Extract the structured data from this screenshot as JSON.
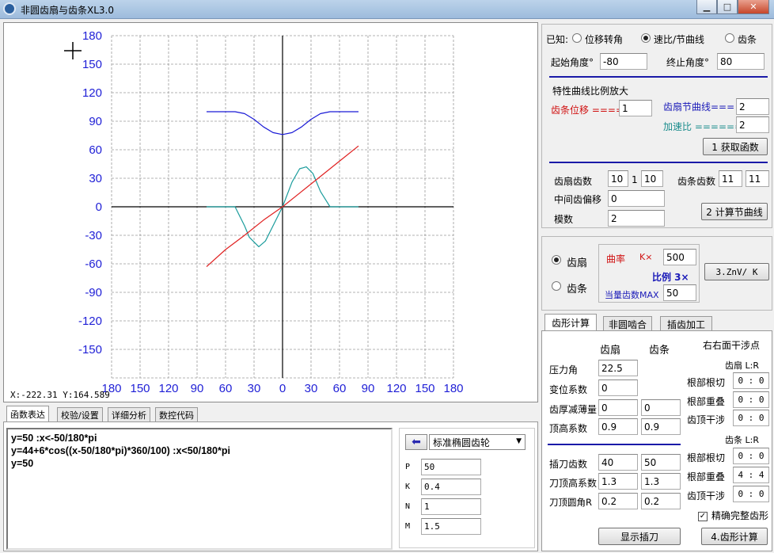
{
  "window": {
    "title": "非圆齿扇与齿条XL3.0"
  },
  "graph": {
    "y_ticks": [
      "180",
      "150",
      "120",
      "90",
      "60",
      "30",
      "0",
      "-30",
      "-60",
      "-90",
      "-120",
      "-150"
    ],
    "x_ticks": [
      "180",
      "150",
      "120",
      "90",
      "60",
      "30",
      "0",
      "30",
      "60",
      "90",
      "120",
      "150",
      "180"
    ],
    "coord_readout": "X:-222.31   Y:164.589",
    "colors": {
      "curve_blue": "#1a1ad6",
      "curve_teal": "#1a9c9c",
      "curve_red": "#e02020"
    }
  },
  "chart_data": {
    "type": "line",
    "x_range": [
      -180,
      180
    ],
    "y_range": [
      -180,
      180
    ],
    "grid": true,
    "series": [
      {
        "color": "#1a1ad6",
        "points": [
          [
            -80,
            100
          ],
          [
            -60,
            100
          ],
          [
            -50,
            100
          ],
          [
            -40,
            98
          ],
          [
            -30,
            92
          ],
          [
            -20,
            84
          ],
          [
            -10,
            78
          ],
          [
            0,
            76
          ],
          [
            10,
            78
          ],
          [
            20,
            84
          ],
          [
            30,
            92
          ],
          [
            40,
            98
          ],
          [
            50,
            100
          ],
          [
            60,
            100
          ],
          [
            80,
            100
          ]
        ]
      },
      {
        "color": "#1a9c9c",
        "points": [
          [
            -80,
            0
          ],
          [
            -50,
            0
          ],
          [
            -40,
            -20
          ],
          [
            -35,
            -32
          ],
          [
            -25,
            -42
          ],
          [
            -18,
            -36
          ],
          [
            -10,
            -20
          ],
          [
            0,
            0
          ],
          [
            10,
            26
          ],
          [
            18,
            40
          ],
          [
            25,
            42
          ],
          [
            32,
            35
          ],
          [
            40,
            16
          ],
          [
            50,
            0
          ],
          [
            80,
            0
          ]
        ]
      },
      {
        "color": "#e02020",
        "points": [
          [
            -80,
            -63
          ],
          [
            -60,
            -45
          ],
          [
            -40,
            -30
          ],
          [
            -20,
            -14
          ],
          [
            0,
            0
          ],
          [
            20,
            16
          ],
          [
            40,
            32
          ],
          [
            60,
            48
          ],
          [
            80,
            64
          ]
        ]
      }
    ]
  },
  "bottom_tabs": [
    "函数表达",
    "校验/设置",
    "详细分析",
    "数控代码"
  ],
  "functions": [
    "y=50 :x<-50/180*pi",
    "y=44+6*cos((x-50/180*pi)*360/100) :x<50/180*pi",
    "y=50"
  ],
  "gear_type": {
    "selected": "标准椭圆齿轮"
  },
  "params": [
    {
      "label": "P",
      "value": "50"
    },
    {
      "label": "K",
      "value": "0.4"
    },
    {
      "label": "N",
      "value": "1"
    },
    {
      "label": "M",
      "value": "1.5"
    }
  ],
  "known": {
    "label": "已知:",
    "options": [
      "位移转角",
      "速比/节曲线",
      "齿条"
    ],
    "selected": "速比/节曲线"
  },
  "angles": {
    "start_label": "起始角度°",
    "start_value": "-80",
    "end_label": "终止角度°",
    "end_value": "80"
  },
  "scale": {
    "heading": "特性曲线比例放大",
    "rack_disp_label": "齿条位移 ====",
    "rack_disp_value": "1",
    "sector_pitch_label": "齿扇节曲线=== =",
    "sector_pitch_value": "2",
    "accel_label": "加速比 ====== =",
    "accel_value": "2",
    "get_func_btn": "1 获取函数"
  },
  "teeth": {
    "sector_label": "齿扇齿数",
    "sector_a": "10",
    "sector_sep": "1",
    "sector_b": "10",
    "rack_label": "齿条齿数",
    "rack_a": "11",
    "rack_b": "11",
    "offset_label": "中间齿偏移",
    "offset_value": "0",
    "module_label": "模数",
    "module_value": "2",
    "calc_pitch_btn": "2 计算节曲线"
  },
  "mode": {
    "options": [
      "齿扇",
      "齿条"
    ],
    "selected": "齿扇",
    "curv_label": "曲率",
    "curv_k": "K×",
    "curv_value": "500",
    "ratio_label": "比例 3×",
    "equiv_label": "当量齿数MAX",
    "equiv_value": "50",
    "znv_btn": "3.ZnV/ K"
  },
  "right_tabs": [
    "齿形计算",
    "非圆啮合",
    "插齿加工"
  ],
  "tooth_calc": {
    "col_sector": "齿扇",
    "col_rack": "齿条",
    "rows": [
      {
        "label": "压力角",
        "a": "22.5"
      },
      {
        "label": "变位系数",
        "a": "0"
      },
      {
        "label": "齿厚减薄量",
        "a": "0",
        "b": "0"
      },
      {
        "label": "顶高系数",
        "a": "0.9",
        "b": "0.9"
      }
    ],
    "cutter_rows": [
      {
        "label": "插刀齿数",
        "a": "40",
        "b": "50"
      },
      {
        "label": "刀顶高系数",
        "a": "1.3",
        "b": "1.3"
      },
      {
        "label": "刀顶圆角R",
        "a": "0.2",
        "b": "0.2"
      }
    ],
    "interference_heading": "右右面干涉点",
    "sector_lr": "齿扇 L:R",
    "sector_checks": [
      {
        "label": "根部根切",
        "value": "0 : 0"
      },
      {
        "label": "根部重叠",
        "value": "0 : 0"
      },
      {
        "label": "齿顶干涉",
        "value": "0 : 0"
      }
    ],
    "rack_lr": "齿条 L:R",
    "rack_checks": [
      {
        "label": "根部根切",
        "value": "0 : 0"
      },
      {
        "label": "根部重叠",
        "value": "4 : 4"
      },
      {
        "label": "齿顶干涉",
        "value": "0 : 0"
      }
    ],
    "precise_label": "精确完整齿形",
    "show_cutter_btn": "显示插刀",
    "calc_btn": "4.齿形计算"
  }
}
